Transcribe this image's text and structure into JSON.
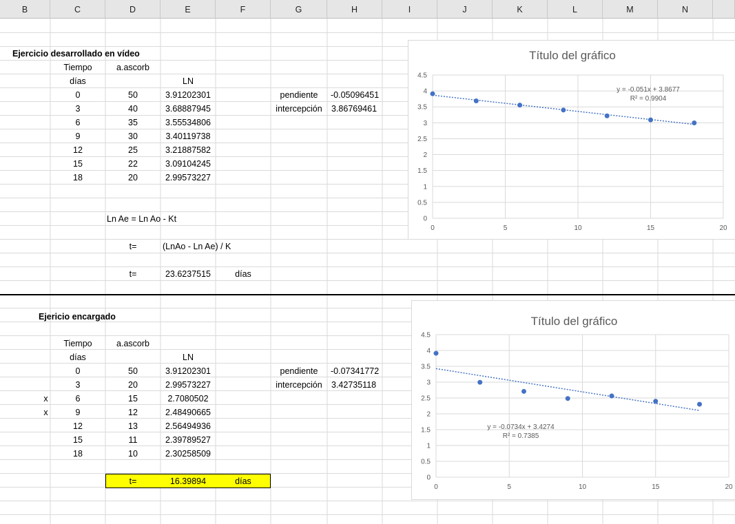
{
  "columns": [
    "B",
    "C",
    "D",
    "E",
    "F",
    "G",
    "H",
    "I",
    "J",
    "K",
    "L",
    "M",
    "N"
  ],
  "video": {
    "title": "Ejercicio desarrollado en vídeo",
    "h_tiempo": "Tiempo",
    "h_ascorb": "a.ascorb",
    "h_dias": "días",
    "h_ln": "LN",
    "rows": [
      {
        "t": "0",
        "a": "50",
        "ln": "3.91202301"
      },
      {
        "t": "3",
        "a": "40",
        "ln": "3.68887945"
      },
      {
        "t": "6",
        "a": "35",
        "ln": "3.55534806"
      },
      {
        "t": "9",
        "a": "30",
        "ln": "3.40119738"
      },
      {
        "t": "12",
        "a": "25",
        "ln": "3.21887582"
      },
      {
        "t": "15",
        "a": "22",
        "ln": "3.09104245"
      },
      {
        "t": "18",
        "a": "20",
        "ln": "2.99573227"
      }
    ],
    "pendiente_label": "pendiente",
    "pendiente_value": "-0.05096451",
    "intercepcion_label": "intercepción",
    "intercepcion_value": "3.86769461",
    "formula1": "Ln Ae = Ln Ao - Kt",
    "t_label1": "t=",
    "formula2": "(LnAo - Ln Ae) / K",
    "t_label2": "t=",
    "t_value": "23.6237515",
    "t_unit": "días"
  },
  "encargado": {
    "title": "Ejericio encargado",
    "h_tiempo": "Tiempo",
    "h_ascorb": "a.ascorb",
    "h_dias": "días",
    "h_ln": "LN",
    "rows": [
      {
        "x": "",
        "t": "0",
        "a": "50",
        "ln": "3.91202301"
      },
      {
        "x": "",
        "t": "3",
        "a": "20",
        "ln": "2.99573227"
      },
      {
        "x": "x",
        "t": "6",
        "a": "15",
        "ln": "2.7080502"
      },
      {
        "x": "x",
        "t": "9",
        "a": "12",
        "ln": "2.48490665"
      },
      {
        "x": "",
        "t": "12",
        "a": "13",
        "ln": "2.56494936"
      },
      {
        "x": "",
        "t": "15",
        "a": "11",
        "ln": "2.39789527"
      },
      {
        "x": "",
        "t": "18",
        "a": "10",
        "ln": "2.30258509"
      }
    ],
    "pendiente_label": "pendiente",
    "pendiente_value": "-0.07341772",
    "intercepcion_label": "intercepción",
    "intercepcion_value": "3.42735118",
    "t_label": "t=",
    "t_value": "16.39894",
    "t_unit": "días"
  },
  "colors": {
    "marker": "#4472c4",
    "highlight": "#ffff00",
    "gridline": "#d9d9d9"
  },
  "chart_data": [
    {
      "type": "scatter",
      "title": "Título del gráfico",
      "x": [
        0,
        3,
        6,
        9,
        12,
        15,
        18
      ],
      "y": [
        3.91202301,
        3.68887945,
        3.55534806,
        3.40119738,
        3.21887582,
        3.09104245,
        2.99573227
      ],
      "xlim": [
        0,
        20
      ],
      "ylim": [
        0,
        4.5
      ],
      "xticks": [
        "0",
        "5",
        "10",
        "15",
        "20"
      ],
      "yticks": [
        "0",
        "0.5",
        "1",
        "1.5",
        "2",
        "2.5",
        "3",
        "3.5",
        "4",
        "4.5"
      ],
      "trendline": {
        "slope": -0.051,
        "intercept": 3.8677,
        "equation": "y = -0.051x + 3.8677",
        "r2": "R² = 0.9904"
      },
      "grid": true
    },
    {
      "type": "scatter",
      "title": "Título del gráfico",
      "x": [
        0,
        3,
        6,
        9,
        12,
        15,
        18
      ],
      "y": [
        3.91202301,
        2.99573227,
        2.7080502,
        2.48490665,
        2.56494936,
        2.39789527,
        2.30258509
      ],
      "xlim": [
        0,
        20
      ],
      "ylim": [
        0,
        4.5
      ],
      "xticks": [
        "0",
        "5",
        "10",
        "15",
        "20"
      ],
      "yticks": [
        "0",
        "0.5",
        "1",
        "1.5",
        "2",
        "2.5",
        "3",
        "3.5",
        "4",
        "4.5"
      ],
      "trendline": {
        "slope": -0.0734,
        "intercept": 3.4274,
        "equation": "y = -0.0734x + 3.4274",
        "r2": "R² = 0.7385"
      },
      "grid": true
    }
  ]
}
